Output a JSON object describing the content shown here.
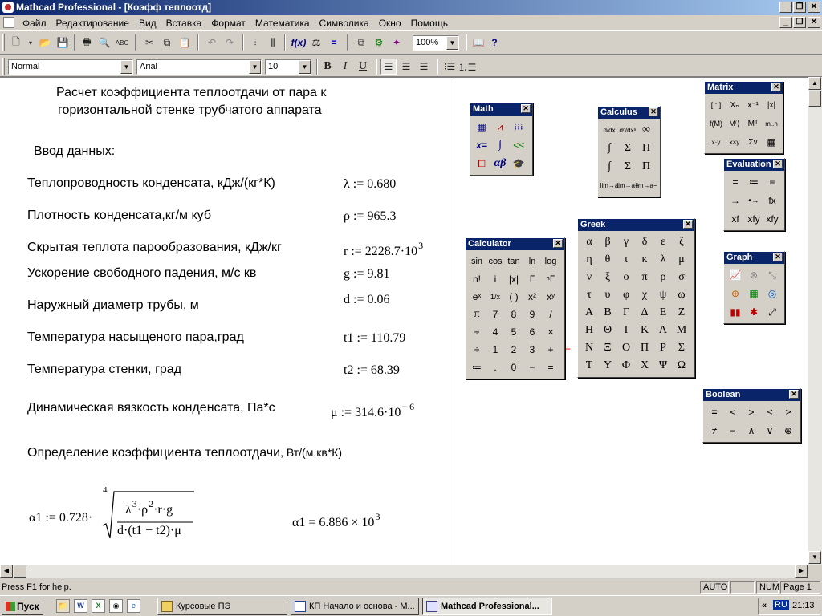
{
  "window": {
    "title": "Mathcad Professional - [Коэфф теплоотд]"
  },
  "menu": [
    "Файл",
    "Редактирование",
    "Вид",
    "Вставка",
    "Формат",
    "Математика",
    "Символика",
    "Окно",
    "Помощь"
  ],
  "toolbar": {
    "zoom": "100%",
    "style": "Normal",
    "font": "Arial",
    "size": "10",
    "bold": "B",
    "italic": "I",
    "underline": "U"
  },
  "doc": {
    "title_line1": "Расчет коэффициента теплоотдачи от пара к",
    "title_line2": "горизонтальной стенке трубчатого аппарата",
    "input_header": "Ввод данных:",
    "params": [
      {
        "label": "Теплопроводность конденсата, кДж/(кг*К)",
        "var": "λ",
        "value": "0.680"
      },
      {
        "label": "Плотность конденсата,кг/м куб",
        "var": "ρ",
        "value": "965.3"
      },
      {
        "label": "Скрытая теплота парообразования, кДж/кг",
        "var": "r",
        "value": "2228.7·10",
        "exp": "3"
      },
      {
        "label": "Ускорение свободного падения, м/с кв",
        "var": "g",
        "value": "9.81"
      },
      {
        "label": "Наружный диаметр трубы, м",
        "var": "d",
        "value": "0.06"
      },
      {
        "label": "Температура насыщеного пара,град",
        "var": "t1",
        "value": "110.79"
      },
      {
        "label": "Температура стенки, град",
        "var": "t2",
        "value": "68.39"
      },
      {
        "label": "Динамическая вязкость конденсата, Па*с",
        "var": "μ",
        "value": "314.6·10",
        "exp": "− 6"
      }
    ],
    "calc_header": "Определение коэффициента теплоотдачи",
    "calc_unit": ", Вт/(м.кв*К)",
    "formula": {
      "lhs": "α1 := 0.728·",
      "root_index": "4",
      "num": "λ",
      "num_e1": "3",
      "num_mid": "·ρ",
      "num_e2": "2",
      "num_tail": "·r·g",
      "den": "d·(t1 − t2)·μ"
    },
    "result": {
      "text": "α1 = 6.886 × 10",
      "exp": "3"
    }
  },
  "palettes": {
    "math": {
      "title": "Math"
    },
    "calculus": {
      "title": "Calculus",
      "cells": [
        "d/dx",
        "dⁿ/dxⁿ",
        "∞",
        "∫",
        "Σ",
        "Π",
        "∫",
        "Σ",
        "Π",
        "lim→a",
        "lim→a+",
        "lim→a−"
      ]
    },
    "matrix": {
      "title": "Matrix",
      "cells": [
        "[:::]",
        "Xₙ",
        "x⁻¹",
        "|x|",
        "f(M)",
        "M⁽⟩",
        "Mᵀ",
        "m..n",
        "x·y",
        "x×y",
        "Σv",
        "▦"
      ]
    },
    "evaluation": {
      "title": "Evaluation",
      "cells": [
        "=",
        "≔",
        "≡",
        "→",
        "•→",
        "fx",
        "xf",
        "xfy",
        "xfy"
      ]
    },
    "calculator": {
      "title": "Calculator",
      "cells": [
        "sin",
        "cos",
        "tan",
        "ln",
        "log",
        "n!",
        "i",
        "|x|",
        "Γ",
        "ⁿΓ",
        "eˣ",
        "1/x",
        "( )",
        "x²",
        "xʸ",
        "π",
        "7",
        "8",
        "9",
        "/",
        "÷",
        "4",
        "5",
        "6",
        "×",
        "÷",
        "1",
        "2",
        "3",
        "+",
        "≔",
        ".",
        "0",
        "−",
        "="
      ]
    },
    "greek": {
      "title": "Greek",
      "cells": [
        "α",
        "β",
        "γ",
        "δ",
        "ε",
        "ζ",
        "η",
        "θ",
        "ι",
        "κ",
        "λ",
        "μ",
        "ν",
        "ξ",
        "ο",
        "π",
        "ρ",
        "σ",
        "τ",
        "υ",
        "φ",
        "χ",
        "ψ",
        "ω",
        "Α",
        "Β",
        "Γ",
        "Δ",
        "Ε",
        "Ζ",
        "Η",
        "Θ",
        "Ι",
        "Κ",
        "Λ",
        "Μ",
        "Ν",
        "Ξ",
        "Ο",
        "Π",
        "Ρ",
        "Σ",
        "Τ",
        "Υ",
        "Φ",
        "Χ",
        "Ψ",
        "Ω"
      ]
    },
    "graph": {
      "title": "Graph"
    },
    "boolean": {
      "title": "Boolean",
      "cells": [
        "=",
        "<",
        ">",
        "≤",
        "≥",
        "≠",
        "¬",
        "∧",
        "∨",
        "⊕"
      ]
    }
  },
  "status": {
    "message": "Press F1 for help.",
    "mode": "AUTO",
    "num": "NUM",
    "page": "Page 1"
  },
  "taskbar": {
    "start": "Пуск",
    "tasks": [
      "Курсовые ПЭ",
      "КП Начало и основа - М...",
      "Mathcad Professional..."
    ],
    "lang": "RU",
    "clock": "21:13"
  }
}
